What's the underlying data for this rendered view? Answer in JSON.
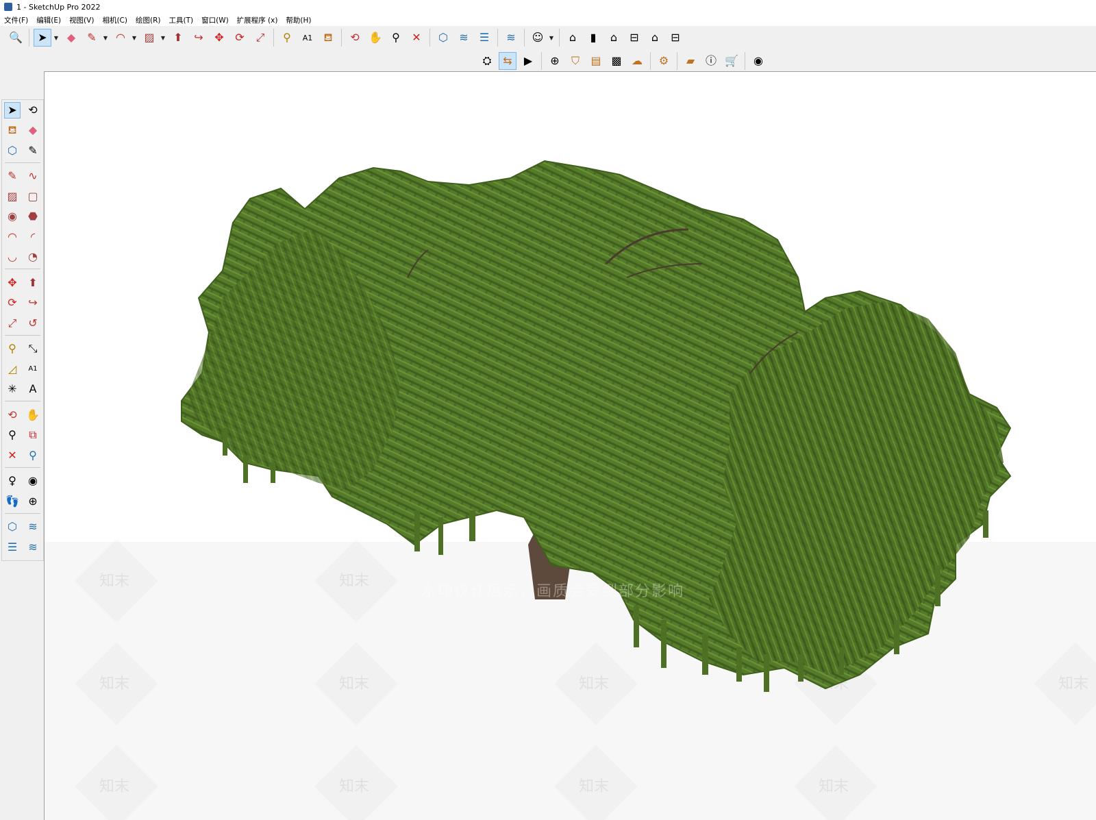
{
  "window": {
    "title": "1 - SketchUp Pro 2022"
  },
  "menu": [
    {
      "id": "file",
      "label": "文件(F)"
    },
    {
      "id": "edit",
      "label": "编辑(E)"
    },
    {
      "id": "view",
      "label": "视图(V)"
    },
    {
      "id": "camera",
      "label": "相机(C)"
    },
    {
      "id": "draw",
      "label": "绘图(R)"
    },
    {
      "id": "tools",
      "label": "工具(T)"
    },
    {
      "id": "window",
      "label": "窗口(W)"
    },
    {
      "id": "extensions",
      "label": "扩展程序 (x)"
    },
    {
      "id": "help",
      "label": "帮助(H)"
    }
  ],
  "toolbar_top": [
    "search-icon",
    "select-arrow-icon",
    "eraser-icon",
    "pencil-icon",
    "arc-icon",
    "rectangle-icon",
    "push-pull-icon",
    "follow-me-icon",
    "move-icon",
    "rotate-icon",
    "scale-icon",
    "tape-measure-icon",
    "text-label-icon",
    "paint-bucket-icon",
    "orbit-icon",
    "pan-icon",
    "zoom-icon",
    "zoom-extents-icon",
    "component-icon",
    "section-plane-icon",
    "layers-icon",
    "section-display-icon",
    "account-icon",
    "iso-view-icon",
    "front-view-icon",
    "house-icon",
    "top-view-icon",
    "outline-house-icon",
    "side-view-icon"
  ],
  "toolbar_second": [
    "3d-warehouse-icon",
    "style-icon",
    "scene-icon",
    "add-circle-icon",
    "shield-icon",
    "report-icon",
    "checker-icon",
    "cloud-upload-icon",
    "gear-settings-icon",
    "chat-icon",
    "info-icon",
    "cart-icon",
    "user-circle-icon"
  ],
  "watermark": {
    "brand": "知末",
    "notice": "水印仅作展示，画质会受到部分影响"
  },
  "colors": {
    "foliage_dark": "#3f5f1c",
    "foliage_mid": "#557a2a",
    "foliage_light": "#6b9436",
    "trunk": "#5e4a3c"
  }
}
